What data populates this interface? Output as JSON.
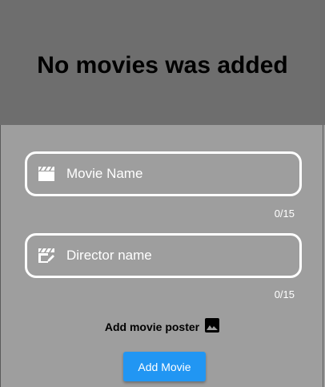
{
  "header": {
    "title": "No movies was added"
  },
  "form": {
    "movie_name": {
      "placeholder": "Movie Name",
      "value": "",
      "counter": "0/15",
      "icon": "movie-clapper-icon"
    },
    "director_name": {
      "placeholder": "Director name",
      "value": "",
      "counter": "0/15",
      "icon": "movie-edit-icon"
    },
    "poster": {
      "label": "Add movie poster",
      "icon": "image-icon"
    },
    "submit_label": "Add Movie"
  },
  "colors": {
    "header_bg": "#6e6e6e",
    "body_bg": "#9e9e9e",
    "accent": "#2196f3",
    "field_border": "#ffffff"
  }
}
